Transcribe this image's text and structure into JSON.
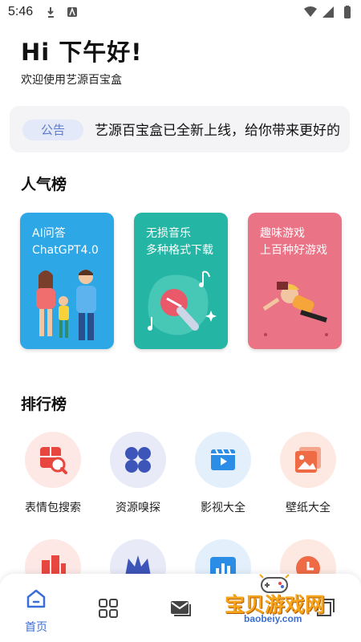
{
  "status_bar": {
    "time": "5:46"
  },
  "header": {
    "greeting": "Hi 下午好!",
    "subtitle": "欢迎使用艺源百宝盒"
  },
  "notice": {
    "tag": "公告",
    "text": "艺源百宝盒已全新上线，给你带来更好的"
  },
  "sections": {
    "popular": "人气榜",
    "ranking": "排行榜"
  },
  "cards": [
    {
      "line1": "AI问答",
      "line2": "ChatGPT4.0",
      "color": "#2ea7e6"
    },
    {
      "line1": "无损音乐",
      "line2": "多种格式下载",
      "color": "#24b5a4"
    },
    {
      "line1": "趣味游戏",
      "line2": "上百种好游戏",
      "color": "#ea7386"
    }
  ],
  "grid": [
    {
      "label": "表情包搜索",
      "icon": "emoji-search-icon",
      "bg": "#fde8e6",
      "fg": "#e8473f"
    },
    {
      "label": "资源嗅探",
      "icon": "clover-icon",
      "bg": "#e8eaf8",
      "fg": "#3d55b8"
    },
    {
      "label": "影视大全",
      "icon": "video-icon",
      "bg": "#e3f0fc",
      "fg": "#2b8de6"
    },
    {
      "label": "壁纸大全",
      "icon": "wallpaper-icon",
      "bg": "#fde9e2",
      "fg": "#ef6b45"
    }
  ],
  "bottom_nav": {
    "home": "首页"
  },
  "watermark": {
    "text": "宝贝游戏网",
    "url": "baobeiy.com"
  }
}
